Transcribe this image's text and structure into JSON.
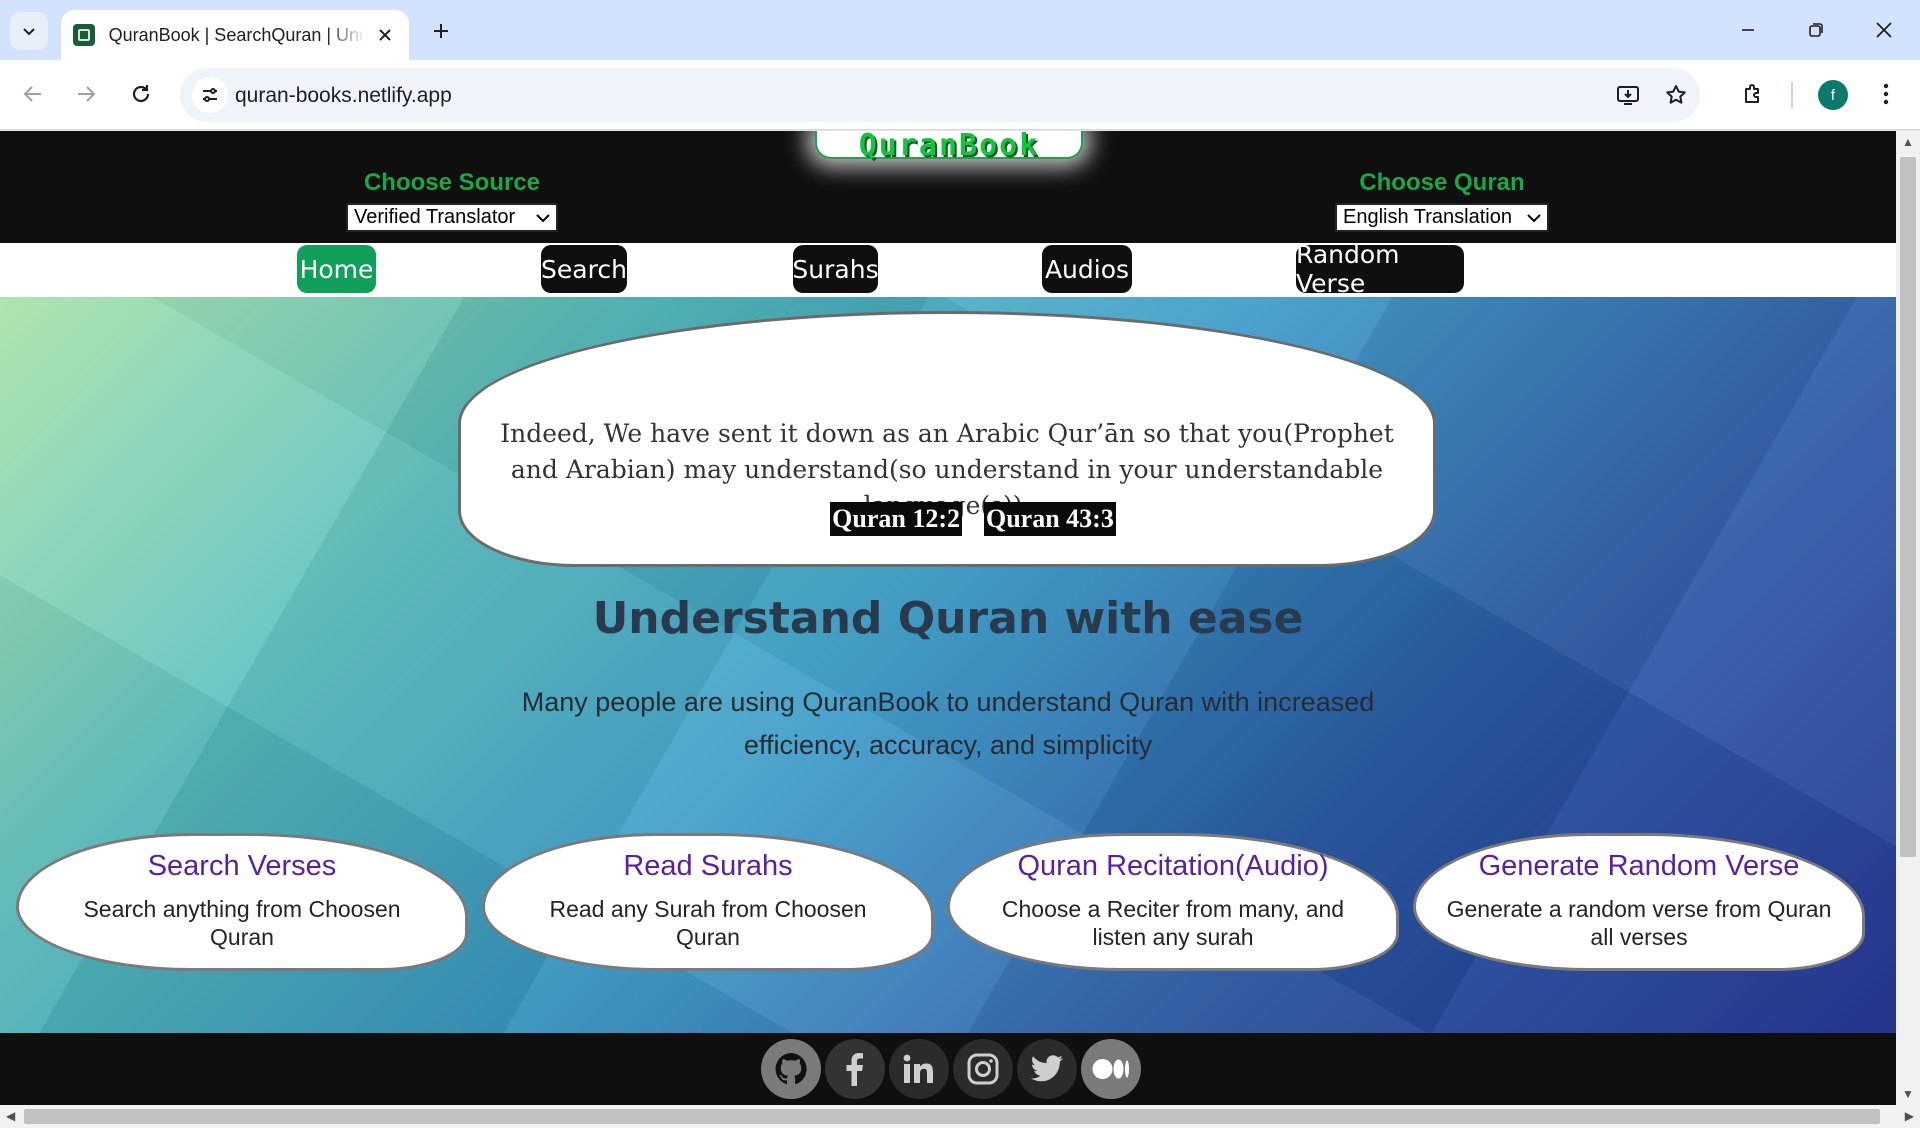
{
  "browser": {
    "tab_title": "QuranBook | SearchQuran | Understand Quran",
    "url": "quran-books.netlify.app",
    "profile_initial": "f"
  },
  "header": {
    "logo_text": "QuranBook",
    "source": {
      "label": "Choose Source",
      "selected": "Verified Translator"
    },
    "quran": {
      "label": "Choose Quran",
      "selected": "English Translation"
    }
  },
  "nav": {
    "items": [
      {
        "label": "Home",
        "active": true
      },
      {
        "label": "Search",
        "active": false
      },
      {
        "label": "Surahs",
        "active": false
      },
      {
        "label": "Audios",
        "active": false
      },
      {
        "label": "Random Verse",
        "active": false
      }
    ]
  },
  "hero": {
    "verse": "Indeed, We have sent it down as an Arabic Qur’ān so that you(Prophet and Arabian) may understand(so understand in your understandable language(s)).",
    "refs": [
      "Quran 12:2",
      "Quran 43:3"
    ],
    "title": "Understand Quran with ease",
    "subtitle": "Many people are using QuranBook to understand Quran with increased efficiency, accuracy, and simplicity"
  },
  "features": [
    {
      "title": "Search Verses",
      "desc": "Search anything from Choosen Quran"
    },
    {
      "title": "Read Surahs",
      "desc": "Read any Surah from Choosen Quran"
    },
    {
      "title": "Quran Recitation(Audio)",
      "desc": "Choose a Reciter from many, and listen any surah"
    },
    {
      "title": "Generate Random Verse",
      "desc": "Generate a random verse from Quran all verses"
    }
  ],
  "footer": {
    "social_icons": [
      "github-icon",
      "facebook-icon",
      "linkedin-icon",
      "instagram-icon",
      "twitter-icon",
      "medium-icon"
    ]
  },
  "colors": {
    "accent_green": "#10a05a",
    "title_green": "#17a84a",
    "feature_purple": "#5b1fa3",
    "dark": "#0f0f0f"
  }
}
